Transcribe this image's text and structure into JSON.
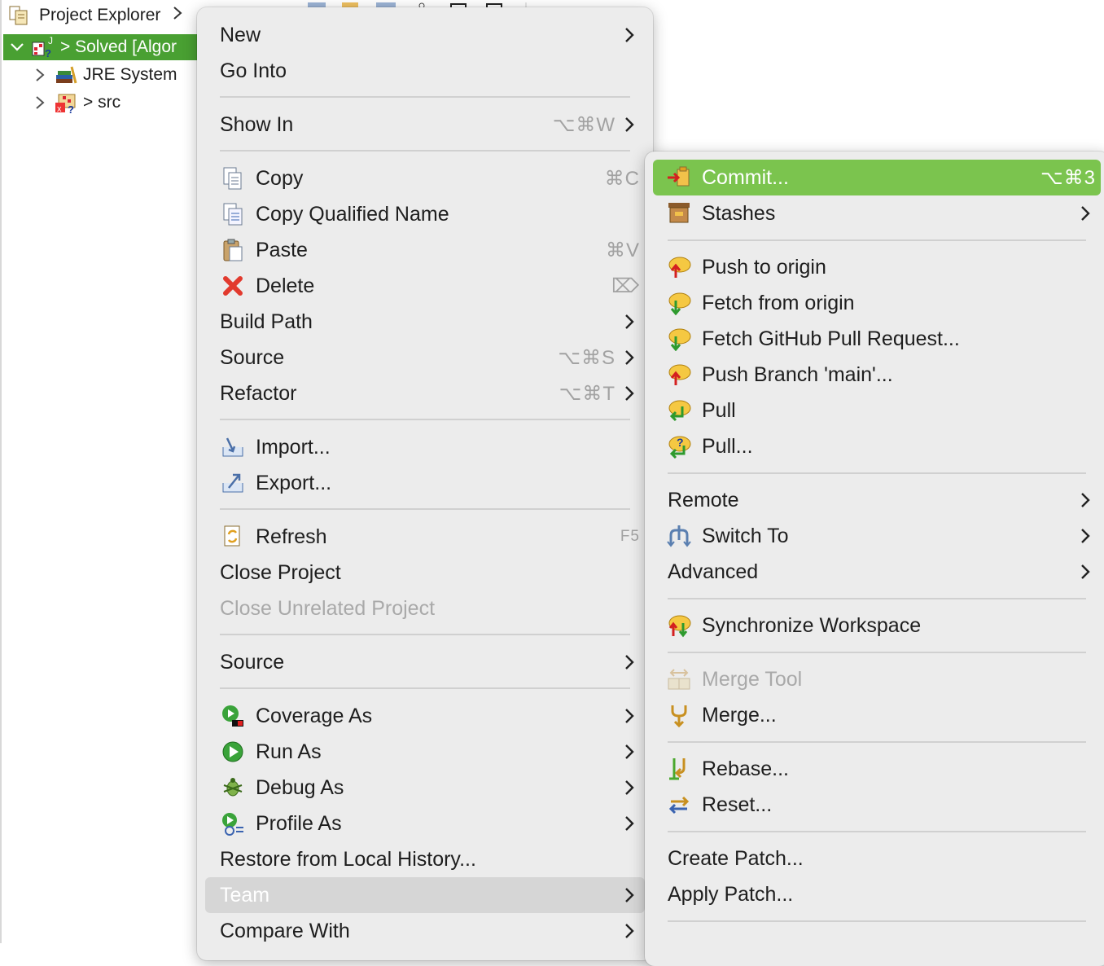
{
  "explorer": {
    "title": "Project Explorer",
    "tree": [
      {
        "label": "> Solved [Algor",
        "expanded": true,
        "selected": true,
        "icon": "project-icon"
      },
      {
        "label": "JRE System",
        "expanded": false,
        "icon": "library-icon"
      },
      {
        "label": "> src",
        "expanded": false,
        "icon": "package-folder-icon"
      }
    ]
  },
  "context_menu": {
    "items": [
      {
        "label": "New",
        "submenu": true
      },
      {
        "label": "Go Into"
      },
      {
        "label": "Show In",
        "shortcut": "⌥⌘W",
        "submenu": true
      },
      {
        "label": "Copy",
        "shortcut": "⌘C",
        "icon": "copy-icon"
      },
      {
        "label": "Copy Qualified Name",
        "icon": "copy-qualified-icon"
      },
      {
        "label": "Paste",
        "shortcut": "⌘V",
        "icon": "paste-icon"
      },
      {
        "label": "Delete",
        "shortcut": "⌦",
        "icon": "delete-icon"
      },
      {
        "label": "Build Path",
        "submenu": true
      },
      {
        "label": "Source",
        "shortcut": "⌥⌘S",
        "submenu": true
      },
      {
        "label": "Refactor",
        "shortcut": "⌥⌘T",
        "submenu": true
      },
      {
        "label": "Import...",
        "icon": "import-icon"
      },
      {
        "label": "Export...",
        "icon": "export-icon"
      },
      {
        "label": "Refresh",
        "shortcut": "F5",
        "icon": "refresh-icon"
      },
      {
        "label": "Close Project"
      },
      {
        "label": "Close Unrelated Project",
        "disabled": true
      },
      {
        "label": "Source",
        "submenu": true
      },
      {
        "label": "Coverage As",
        "submenu": true,
        "icon": "coverage-icon"
      },
      {
        "label": "Run As",
        "submenu": true,
        "icon": "run-icon"
      },
      {
        "label": "Debug As",
        "submenu": true,
        "icon": "debug-icon"
      },
      {
        "label": "Profile As",
        "submenu": true,
        "icon": "profile-icon"
      },
      {
        "label": "Restore from Local History..."
      },
      {
        "label": "Team",
        "submenu": true,
        "highlighted": true
      },
      {
        "label": "Compare With",
        "submenu": true
      }
    ]
  },
  "team_menu": {
    "items": [
      {
        "label": "Commit...",
        "shortcut": "⌥⌘3",
        "icon": "commit-icon",
        "active": true
      },
      {
        "label": "Stashes",
        "submenu": true,
        "icon": "stashes-icon"
      },
      {
        "label": "Push to origin",
        "icon": "push-icon"
      },
      {
        "label": "Fetch from origin",
        "icon": "fetch-icon"
      },
      {
        "label": "Fetch GitHub Pull Request...",
        "icon": "fetch-pr-icon"
      },
      {
        "label": "Push Branch 'main'...",
        "icon": "push-branch-icon"
      },
      {
        "label": "Pull",
        "icon": "pull-icon"
      },
      {
        "label": "Pull...",
        "icon": "pull-dialog-icon"
      },
      {
        "label": "Remote",
        "submenu": true
      },
      {
        "label": "Switch To",
        "submenu": true,
        "icon": "switch-icon"
      },
      {
        "label": "Advanced",
        "submenu": true
      },
      {
        "label": "Synchronize Workspace",
        "icon": "synchronize-icon"
      },
      {
        "label": "Merge Tool",
        "disabled": true,
        "icon": "merge-tool-icon"
      },
      {
        "label": "Merge...",
        "icon": "merge-icon"
      },
      {
        "label": "Rebase...",
        "icon": "rebase-icon"
      },
      {
        "label": "Reset...",
        "icon": "reset-icon"
      },
      {
        "label": "Create Patch..."
      },
      {
        "label": "Apply Patch..."
      }
    ]
  },
  "colors": {
    "selection_green": "#49a032",
    "active_item_green": "#7bc44e",
    "menu_background": "#ececec",
    "highlight_gray": "#d6d6d6"
  }
}
